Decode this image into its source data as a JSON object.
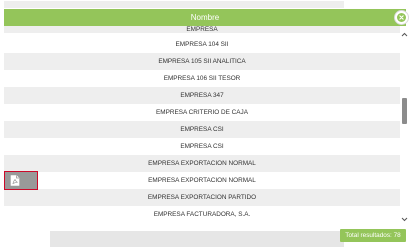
{
  "header": {
    "title": "Nombre",
    "color": "#94c55a"
  },
  "close_button": {
    "icon": "close-icon"
  },
  "list": {
    "items": [
      {
        "label": "EMPRESA"
      },
      {
        "label": "EMPRESA 104 SII"
      },
      {
        "label": "EMPRESA 105 SII ANALITICA"
      },
      {
        "label": "EMPRESA 106 SII TESOR"
      },
      {
        "label": "EMPRESA 347"
      },
      {
        "label": "EMPRESA CRITERIO DE CAJA"
      },
      {
        "label": "EMPRESA CSI"
      },
      {
        "label": "EMPRESA CSI"
      },
      {
        "label": "EMPRESA EXPORTACION NORMAL"
      },
      {
        "label": "EMPRESA EXPORTACION NORMAL"
      },
      {
        "label": "EMPRESA EXPORTACION PARTIDO"
      },
      {
        "label": "EMPRESA FACTURADORA, S.A."
      }
    ]
  },
  "scrollbar": {
    "up_icon": "chevron-up-icon",
    "down_icon": "chevron-down-icon"
  },
  "pdf_button": {
    "icon": "pdf-file-icon",
    "highlight_color": "#cc0a2a"
  },
  "footer": {
    "total_label": "Total resultados: 78"
  }
}
